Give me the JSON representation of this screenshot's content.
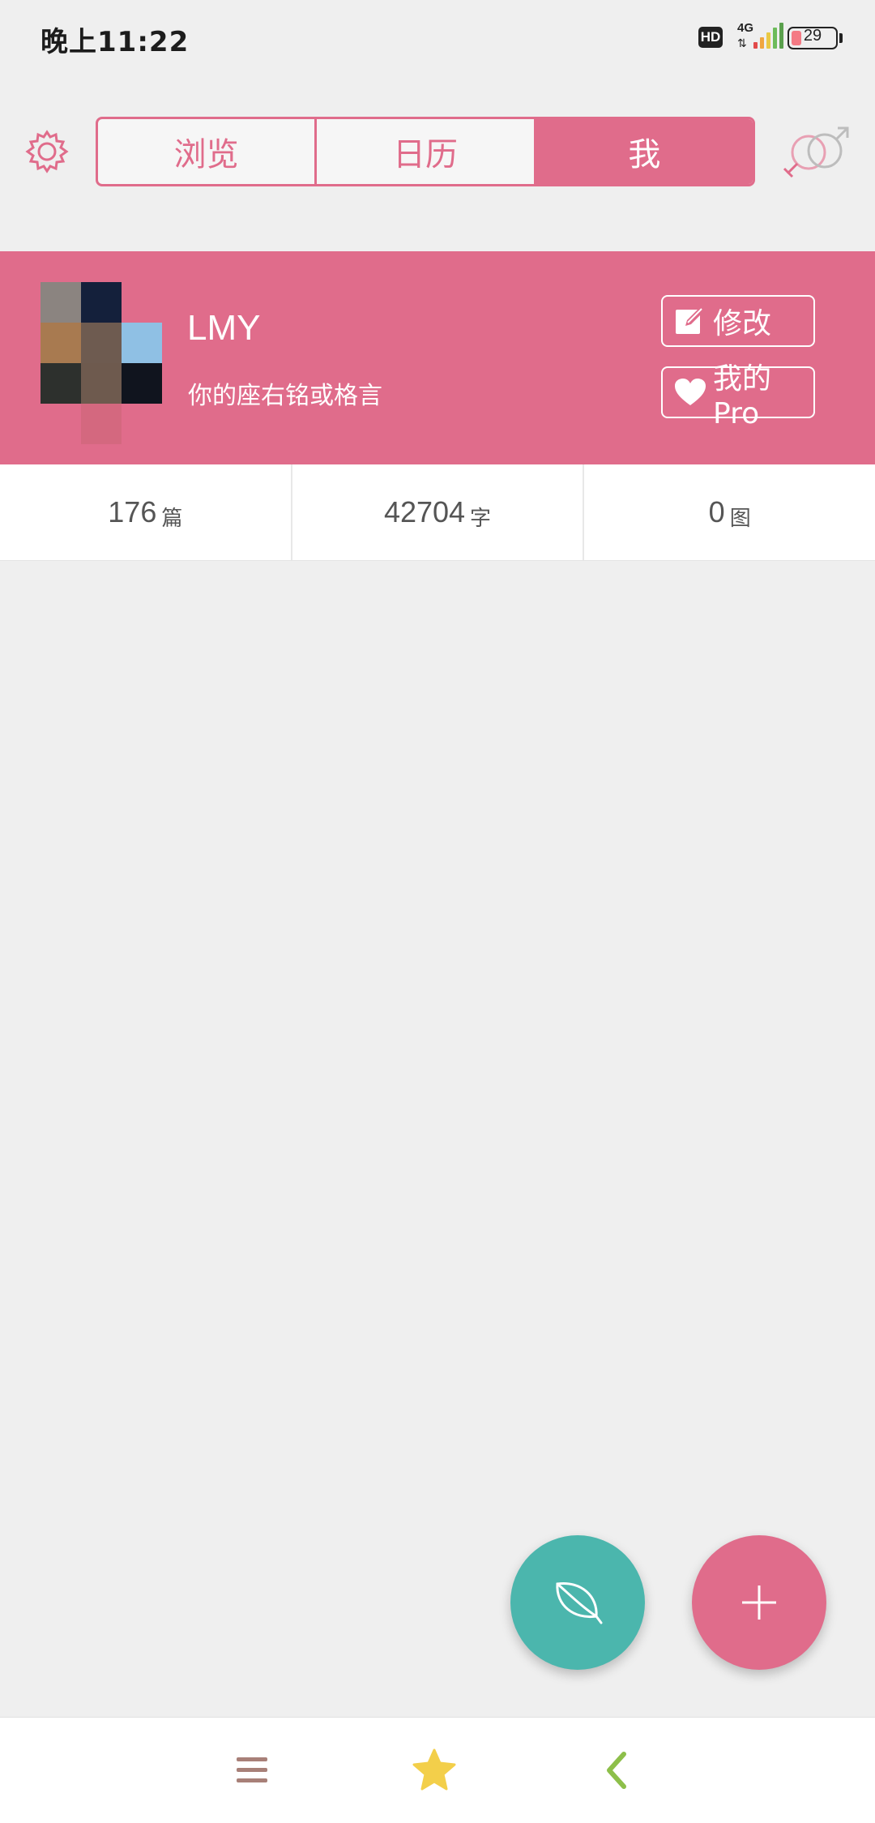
{
  "status_bar": {
    "time": "晚上11:22",
    "hd": "HD",
    "network": "4G",
    "network_arrows": "⇅",
    "battery": "29"
  },
  "header": {
    "tabs": [
      {
        "label": "浏览"
      },
      {
        "label": "日历"
      },
      {
        "label": "我",
        "active": true
      }
    ]
  },
  "profile": {
    "name": "LMY",
    "motto": "你的座右铭或格言",
    "edit_label": "修改",
    "pro_label": "我的Pro"
  },
  "stats": [
    {
      "value": "176",
      "unit": "篇"
    },
    {
      "value": "42704",
      "unit": "字"
    },
    {
      "value": "0",
      "unit": "图"
    }
  ],
  "colors": {
    "accent": "#e06c8b",
    "teal": "#4bb6ad",
    "background": "#efefef"
  },
  "icons": {
    "settings": "gear-icon",
    "gender": "gender-icon",
    "leaf_fab": "leaf-icon",
    "add_fab": "plus-icon",
    "bottom": [
      "menu-icon",
      "star-icon",
      "back-icon"
    ]
  }
}
